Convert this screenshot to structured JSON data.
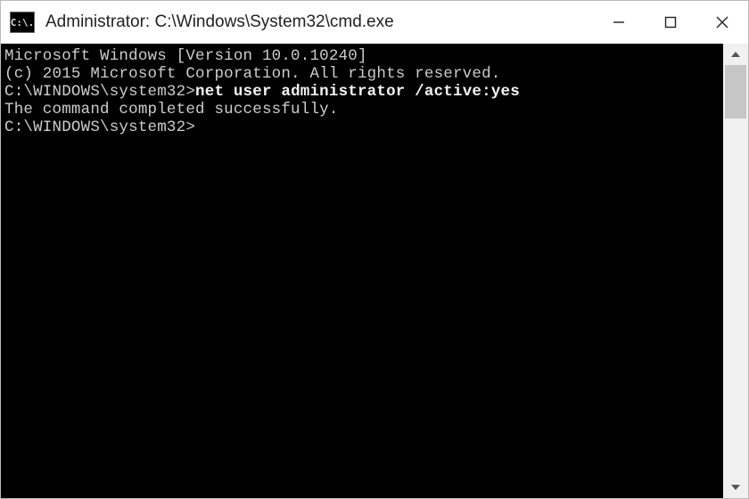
{
  "window": {
    "icon_text": "C:\\.",
    "title": "Administrator: C:\\Windows\\System32\\cmd.exe"
  },
  "terminal": {
    "line1": "Microsoft Windows [Version 10.0.10240]",
    "line2": "(c) 2015 Microsoft Corporation. All rights reserved.",
    "blank1": "",
    "prompt1": "C:\\WINDOWS\\system32>",
    "cmd1": "net user administrator /active:yes",
    "result1": "The command completed successfully.",
    "blank2": "",
    "blank3": "",
    "prompt2": "C:\\WINDOWS\\system32>"
  }
}
